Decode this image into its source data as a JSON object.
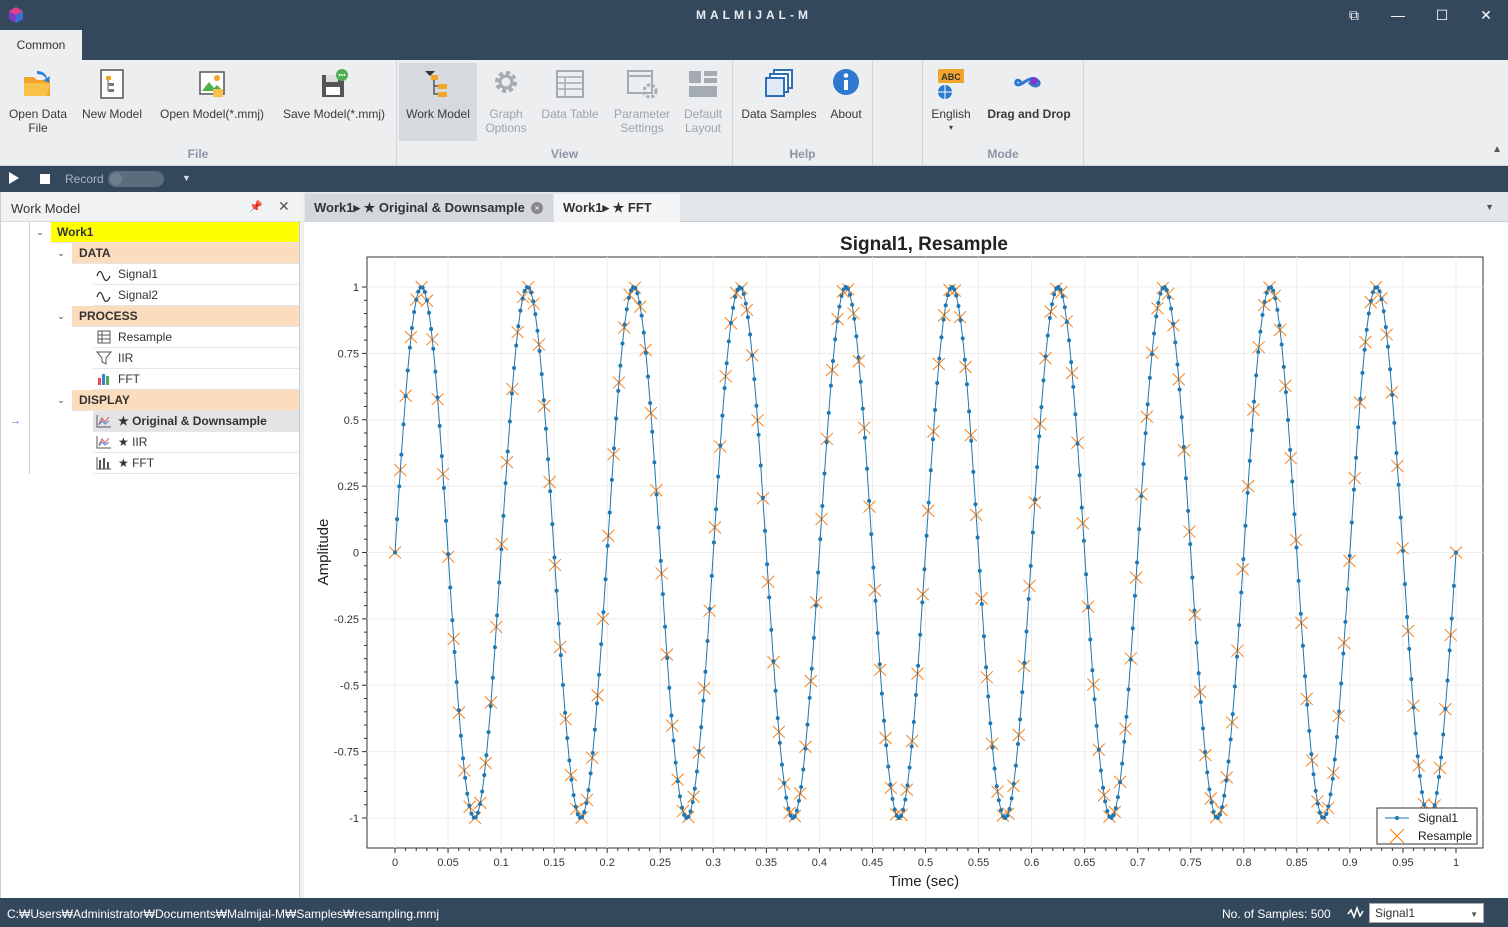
{
  "app": {
    "title": "MALMIJAL-M",
    "window_controls": [
      "⧉",
      "—",
      "☐",
      "✕"
    ]
  },
  "ribbon": {
    "tab": "Common",
    "groups": {
      "file": {
        "label": "File",
        "open_data_file": "Open Data File",
        "new_model": "New Model",
        "open_model": "Open Model(*.mmj)",
        "save_model": "Save Model(*.mmj)"
      },
      "view": {
        "label": "View",
        "work_model": "Work Model",
        "graph_options": "Graph Options",
        "data_table": "Data Table",
        "parameter_settings": "Parameter Settings",
        "default_layout": "Default Layout"
      },
      "help": {
        "label": "Help",
        "data_samples": "Data Samples",
        "about": "About"
      },
      "mode": {
        "label": "Mode",
        "language": "English",
        "language_badge": "ABC",
        "drag_and_drop": "Drag and Drop"
      }
    }
  },
  "recordbar": {
    "record_label": "Record"
  },
  "work_model": {
    "title": "Work Model",
    "root": "Work1",
    "sections": [
      {
        "label": "DATA",
        "items": [
          "Signal1",
          "Signal2"
        ]
      },
      {
        "label": "PROCESS",
        "items": [
          "Resample",
          "IIR",
          "FFT"
        ]
      },
      {
        "label": "DISPLAY",
        "items": [
          "★ Original & Downsample",
          "★ IIR",
          "★ FFT"
        ]
      }
    ]
  },
  "doc_tabs": [
    {
      "label": "Work1▸ ★ Original & Downsample",
      "close": "×"
    },
    {
      "label": "Work1▸ ★ FFT"
    }
  ],
  "chart_data": {
    "type": "line",
    "title": "Signal1, Resample",
    "xlabel": "Time (sec)",
    "ylabel": "Amplitude",
    "xlim": [
      0,
      1
    ],
    "ylim": [
      -1,
      1
    ],
    "x_ticks": [
      "0",
      "0.05",
      "0.1",
      "0.15",
      "0.2",
      "0.25",
      "0.3",
      "0.35",
      "0.4",
      "0.45",
      "0.5",
      "0.55",
      "0.6",
      "0.65",
      "0.7",
      "0.75",
      "0.8",
      "0.85",
      "0.9",
      "0.95",
      "1"
    ],
    "y_ticks": [
      "1",
      "0.75",
      "0.5",
      "0.25",
      "0",
      "-0.25",
      "-0.5",
      "-0.75",
      "-1"
    ],
    "grid": true,
    "legend_position": "bottom-right",
    "series": [
      {
        "name": "Signal1",
        "color": "#1f77b4",
        "marker": "dot",
        "function": "sin(2*pi*10*t)",
        "t_start": 0,
        "t_end": 1,
        "samples": 500
      },
      {
        "name": "Resample",
        "color": "#ff7f0e",
        "marker": "x",
        "function": "sin(2*pi*10*t)",
        "t_start": 0,
        "t_end": 1,
        "samples": 200
      }
    ]
  },
  "statusbar": {
    "path": "C:₩Users₩Administrator₩Documents₩Malmijal-M₩Samples₩resampling.mmj",
    "samples": "No. of Samples: 500",
    "signal_select": "Signal1"
  }
}
